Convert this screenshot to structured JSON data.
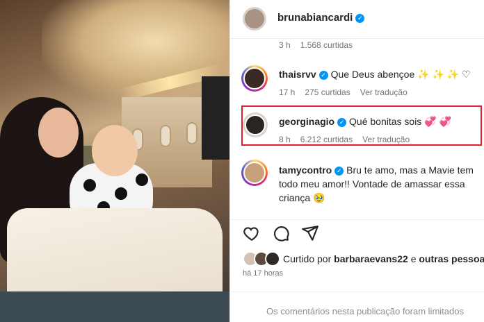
{
  "post": {
    "author": "brunabiancardi"
  },
  "comments": [
    {
      "meta_time": "3 h",
      "meta_likes": "1.568 curtidas"
    },
    {
      "username": "thaisrvv",
      "text": "Que Deus abençoe ✨ ✨ ✨ ♡",
      "time": "17 h",
      "likes": "275 curtidas",
      "translate": "Ver tradução"
    },
    {
      "username": "georginagio",
      "text": "Qué bonitas sois 💞 💞",
      "time": "8 h",
      "likes": "6.212 curtidas",
      "translate": "Ver tradução"
    },
    {
      "username": "tamycontro",
      "text_line1": "Bru te amo, mas a Mavie tem",
      "text_line2": "todo meu amor!! Vontade de amassar essa",
      "text_line3": "criança 🥹"
    }
  ],
  "likes": {
    "prefix": "Curtido por",
    "user": "barbaraevans22",
    "connector": "e",
    "others": "outras pessoas"
  },
  "timestamp": "há 17 horas",
  "limited_notice": "Os comentários nesta publicação foram limitados",
  "colors": {
    "verified": "#0095f6",
    "highlight": "#e11d2b",
    "muted": "#737373"
  }
}
